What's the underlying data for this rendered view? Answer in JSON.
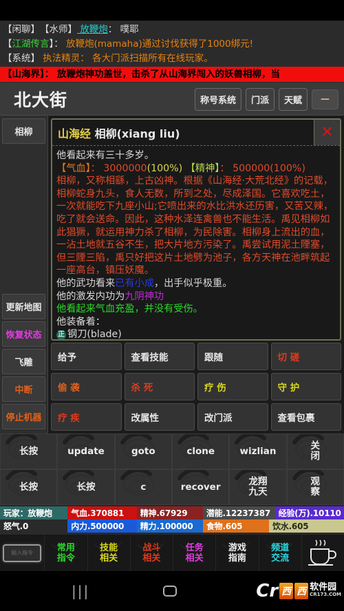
{
  "chat": {
    "lines": [
      {
        "segments": [
          {
            "t": "【闲聊】",
            "c": "wh"
          },
          {
            "t": "　【水师】",
            "c": "wh"
          },
          {
            "t": " 放鞭炮",
            "c": "cy"
          },
          {
            "t": "：  噗耶",
            "c": "wh"
          }
        ]
      },
      {
        "segments": [
          {
            "t": "【",
            "c": "wh"
          },
          {
            "t": "江湖传言",
            "c": "gr"
          },
          {
            "t": "】：  ",
            "c": "wh"
          },
          {
            "t": "放鞭炮(mamaha)通过讨伐获得了1000绑元!",
            "c": "or"
          }
        ]
      },
      {
        "segments": [
          {
            "t": "【系统】",
            "c": "wh"
          },
          {
            "t": "  执法精灵：  各大门派扫描所有在线玩家。",
            "c": "or"
          }
        ]
      }
    ],
    "banner": "【山海界】：  放鞭炮神功盖世，击杀了从山海界闯入的妖兽相柳，当"
  },
  "titlebar": {
    "room": "北大街",
    "buttons": [
      "称号系统",
      "门派",
      "天赋"
    ],
    "collapse_label": "—"
  },
  "rail": {
    "top_items": [
      {
        "label": "相柳",
        "color": "white"
      }
    ],
    "bottom_items": [
      {
        "label": "更新地图",
        "color": "white"
      },
      {
        "label": "恢复状态",
        "color": "magenta"
      },
      {
        "label": "飞雕",
        "color": "white"
      },
      {
        "label": "中断",
        "color": "orange"
      },
      {
        "label": "停止机器",
        "color": "orange"
      }
    ]
  },
  "panel": {
    "title_prefix": "山海经",
    "title_name": "相柳(xiang liu)",
    "close_label": "✕",
    "age_line": "他看起来有三十多岁。",
    "stats": {
      "hp_label": "【气血】",
      "hp_sep": "：",
      "hp_value": "3000000",
      "hp_pct": "(100%)",
      "sp_label": "【精神】",
      "sp_sep": "：",
      "sp_value": "500000",
      "sp_pct": "(100%)"
    },
    "lore": "相柳，又称相繇，上古凶神。根据《山海经·大荒北经》的记载，相柳蛇身九头，食人无数，所到之处，尽成泽国。它喜欢吃土，一次就能吃下九座小山;它喷出来的水比洪水还历害，又苦又辣，吃了就会送命。因此，这种水泽连禽兽也不能生活。禹见相柳如此猖獗，就运用神力杀了相柳，为民除害。相柳身上流出的血，一沾土地就五谷不生，把大片地方污染了。禹尝试用泥土陻塞，但三陻三陷，禹只好把这片土地劈为池子，各方天神在池畔筑起一座高台，镇压妖魔。",
    "skill_line_pre": "他的武功看来",
    "skill_level": "已有小成",
    "skill_line_post": "，出手似乎极重。",
    "inner_pre": "他的激发内功为",
    "inner_name": "九阴神功",
    "health_line": "他看起来气血充盈，并没有受伤。",
    "equip_label": "他装备着：",
    "equip_badge": "正",
    "equip_item": "钢刀(blade)"
  },
  "actions": {
    "rows": [
      [
        {
          "label": "给予",
          "color": "white"
        },
        {
          "label": "查看技能",
          "color": "white"
        },
        {
          "label": "跟随",
          "color": "white"
        },
        {
          "label": "切 磋",
          "color": "red"
        }
      ],
      [
        {
          "label": "偷 袭",
          "color": "orange"
        },
        {
          "label": "杀 死",
          "color": "red"
        },
        {
          "label": "疗 伤",
          "color": "yellow"
        },
        {
          "label": "守 护",
          "color": "yellow"
        }
      ],
      [
        {
          "label": "疗 疾",
          "color": "red"
        },
        {
          "label": "改属性",
          "color": "white"
        },
        {
          "label": "改门派",
          "color": "white"
        },
        {
          "label": "查看包裹",
          "color": "white"
        }
      ]
    ]
  },
  "commands": {
    "row1": [
      "长按",
      "update",
      "goto",
      "clone",
      "wizlian",
      "关\n闭"
    ],
    "row2": [
      "长按",
      "长按",
      "c",
      "recover",
      "龙翔\n九天",
      "观\n察"
    ]
  },
  "stats_bar": {
    "row1": [
      {
        "label": "玩家：放鞭炮",
        "bg": "#2d6a66",
        "flex": 2.05
      },
      {
        "label": "气血.370881",
        "bg": "#cc1111",
        "flex": 2.1
      },
      {
        "label": "精神.67929",
        "bg": "#8a2222",
        "flex": 2.0
      },
      {
        "label": "潜能.12237387",
        "bg": "#4a4a4a",
        "flex": 2.2
      },
      {
        "label": "经验(万).10110",
        "bg": "#5a2ad0",
        "flex": 2.1
      }
    ],
    "row2": [
      {
        "label": "怒气.0",
        "bg": "transparent",
        "flex": 2.05
      },
      {
        "label": "内力.500000",
        "bg": "#1a5ad8",
        "flex": 2.1
      },
      {
        "label": "精力.100000",
        "bg": "#1a6ad0",
        "flex": 2.0
      },
      {
        "label": "食物.605",
        "bg": "#e0701a",
        "flex": 2.0
      },
      {
        "label": "饮水.605",
        "bg": "#c8c890",
        "flex": 2.3
      }
    ]
  },
  "bottom_nav": {
    "input_placeholder": "输入指令",
    "items": [
      {
        "label": "常用\n指令",
        "color": "c-green"
      },
      {
        "label": "技能\n相关",
        "color": "c-yellow"
      },
      {
        "label": "战斗\n相关",
        "color": "c-red"
      },
      {
        "label": "任务\n相关",
        "color": "c-magenta"
      },
      {
        "label": "游戏\n指南",
        "color": "c-white"
      },
      {
        "label": "频道\n交流",
        "color": "c-cyan"
      }
    ],
    "cup_icon": "coffee-cup-icon"
  },
  "android_nav": {
    "recent_icon": "|||",
    "home_icon": "home-rounded-square-icon",
    "watermark": {
      "cr": "Cr",
      "xi1": "西",
      "xi2": "西",
      "name": "软件园",
      "domain": "CR173.COM"
    }
  },
  "colors": {
    "accent_panel_border": "#6d7257",
    "banner_red": "#f20d0d",
    "title_bg": "#3a3a3a"
  }
}
